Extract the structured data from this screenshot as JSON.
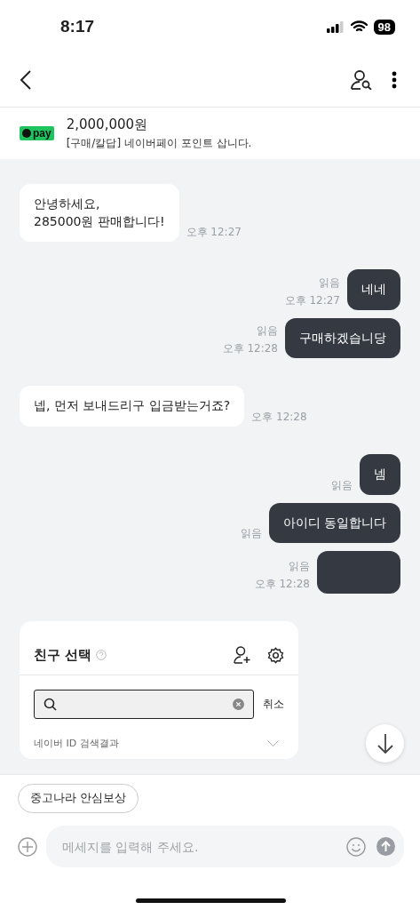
{
  "status_bar": {
    "time": "8:17",
    "battery": "98"
  },
  "product": {
    "badge": "pay",
    "price": "2,000,000원",
    "title": "[구매/칼답] 네이버페이 포인트 삽니다."
  },
  "messages": [
    {
      "kind": "incoming",
      "text": "안녕하세요,\n285000원 판매합니다!",
      "time": "오후 12:27"
    },
    {
      "kind": "outgoing",
      "text": "네네",
      "read": "읽음",
      "time": "오후 12:27"
    },
    {
      "kind": "outgoing",
      "text": "구매하겠습니당",
      "read": "읽음",
      "time": "오후 12:28"
    },
    {
      "kind": "incoming",
      "text": "넵, 먼저 보내드리구 입금받는거죠?",
      "time": "오후 12:28"
    },
    {
      "kind": "outgoing",
      "text": "넴",
      "read": "읽음"
    },
    {
      "kind": "outgoing",
      "text": "아이디 동일합니다",
      "read": "읽음"
    },
    {
      "kind": "outgoing",
      "read": "읽음",
      "time": "오후 12:28"
    }
  ],
  "friend_card": {
    "title": "친구 선택",
    "cancel": "취소",
    "section": "네이버 ID 검색결과"
  },
  "chip": "중고나라 안심보상",
  "composer": {
    "placeholder": "메세지를 입력해 주세요."
  }
}
